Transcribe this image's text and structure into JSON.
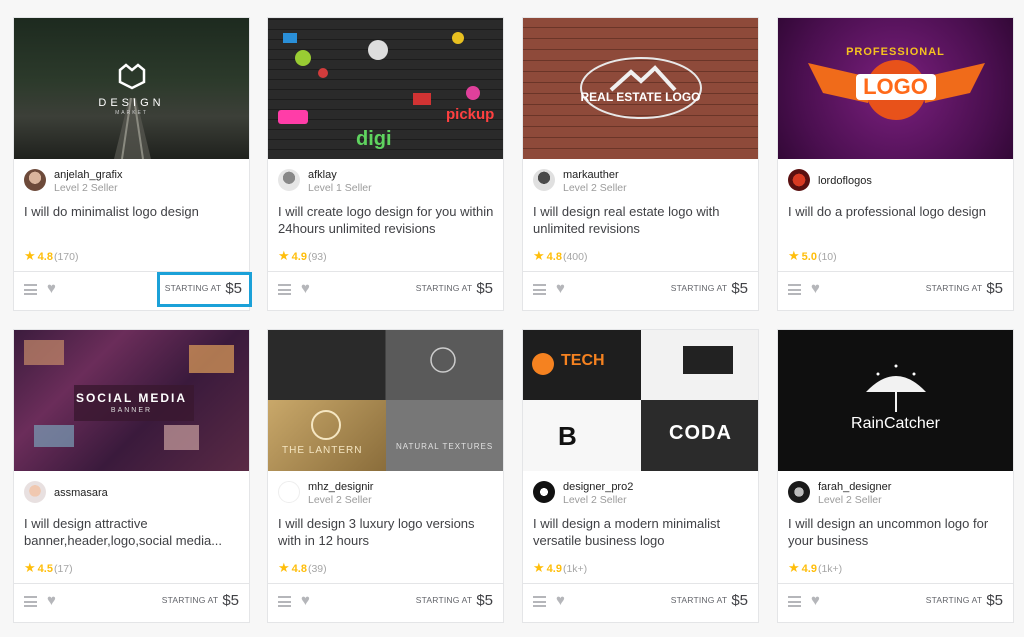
{
  "price_label": "STARTING AT",
  "colors": {
    "star": "#ffbe0b",
    "highlight_border": "#1ba1d8"
  },
  "gigs": [
    {
      "thumb_text": "DESIGN",
      "thumb_subtext": "MARKET",
      "seller_name": "anjelah_grafix",
      "seller_level": "Level 2 Seller",
      "title": "I will do minimalist logo design",
      "rating": "4.8",
      "reviews": "(170)",
      "price": "$5"
    },
    {
      "thumb_text": "digi",
      "thumb_subtext": "pickup",
      "seller_name": "afklay",
      "seller_level": "Level 1 Seller",
      "title": "I will create logo design for you within 24hours unlimited revisions",
      "rating": "4.9",
      "reviews": "(93)",
      "price": "$5"
    },
    {
      "thumb_text": "REAL ESTATE LOGO",
      "thumb_subtext": "",
      "seller_name": "markauther",
      "seller_level": "Level 2 Seller",
      "title": "I will design real estate logo with unlimited revisions",
      "rating": "4.8",
      "reviews": "(400)",
      "price": "$5"
    },
    {
      "thumb_text": "LOGO",
      "thumb_subtext": "PROFESSIONAL",
      "seller_name": "lordoflogos",
      "seller_level": "",
      "title": "I will do a professional logo design",
      "rating": "5.0",
      "reviews": "(10)",
      "price": "$5"
    },
    {
      "thumb_text": "SOCIAL MEDIA",
      "thumb_subtext": "BANNER",
      "seller_name": "assmasara",
      "seller_level": "",
      "title": "I will design attractive banner,header,logo,social media...",
      "rating": "4.5",
      "reviews": "(17)",
      "price": "$5"
    },
    {
      "thumb_text": "THE LANTERN",
      "thumb_subtext": "NATURAL TEXTURES",
      "seller_name": "mhz_designir",
      "seller_level": "Level 2 Seller",
      "title": "I will design 3 luxury logo versions with in 12 hours",
      "rating": "4.8",
      "reviews": "(39)",
      "price": "$5"
    },
    {
      "thumb_text": "TECH",
      "thumb_subtext": "CODA",
      "seller_name": "designer_pro2",
      "seller_level": "Level 2 Seller",
      "title": "I will design a modern minimalist versatile business logo",
      "rating": "4.9",
      "reviews": "(1k+)",
      "price": "$5"
    },
    {
      "thumb_text": "RainCatcher",
      "thumb_subtext": "",
      "seller_name": "farah_designer",
      "seller_level": "Level 2 Seller",
      "title": "I will design an uncommon logo for your business",
      "rating": "4.9",
      "reviews": "(1k+)",
      "price": "$5"
    }
  ]
}
